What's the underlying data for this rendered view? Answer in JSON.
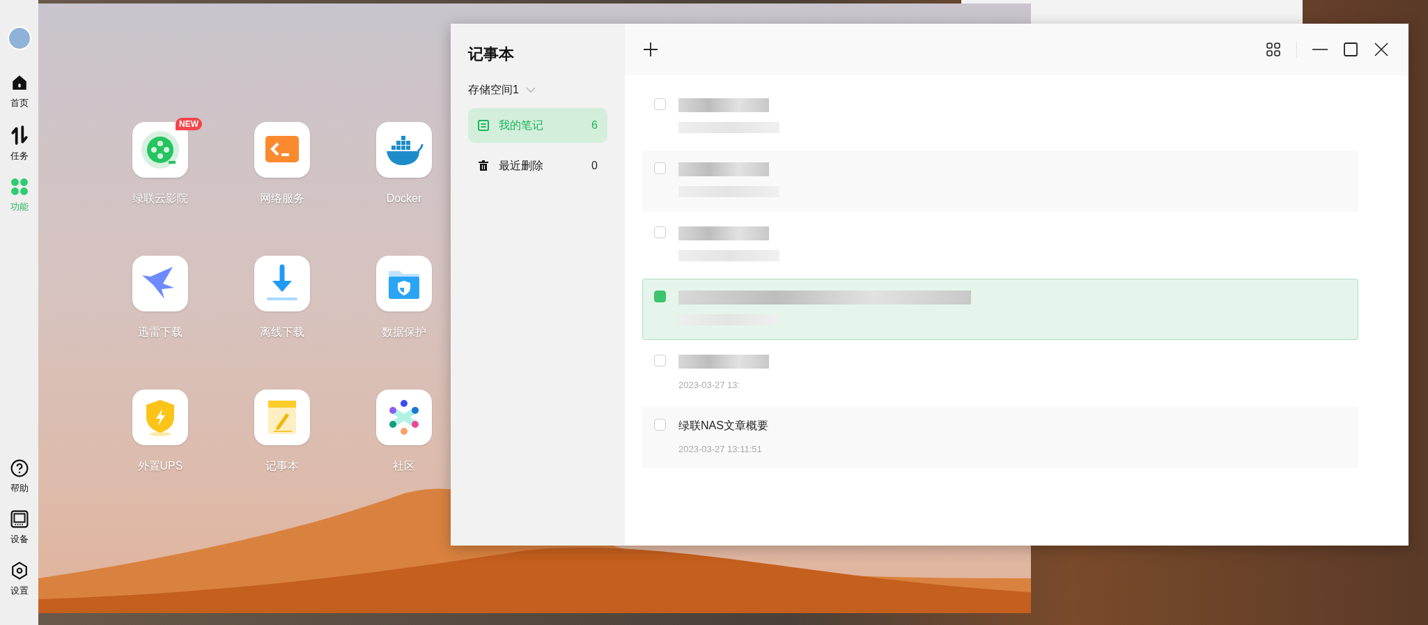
{
  "sidebar": {
    "items": [
      {
        "label": "首页",
        "selected": false
      },
      {
        "label": "任务",
        "selected": false
      },
      {
        "label": "功能",
        "selected": true
      }
    ],
    "bottom_items": [
      {
        "label": "帮助"
      },
      {
        "label": "设备"
      },
      {
        "label": "设置"
      }
    ]
  },
  "desktop": {
    "apps": [
      {
        "label": "绿联云影院",
        "badge": "NEW"
      },
      {
        "label": "网络服务"
      },
      {
        "label": "Docker"
      },
      {
        "label": "迅雷下载"
      },
      {
        "label": "离线下载"
      },
      {
        "label": "数据保护"
      },
      {
        "label": "外置UPS"
      },
      {
        "label": "记事本"
      },
      {
        "label": "社区"
      }
    ]
  },
  "notepad": {
    "title": "记事本",
    "storage": "存储空间1",
    "folders": [
      {
        "label": "我的笔记",
        "count": "6",
        "selected": true
      },
      {
        "label": "最近删除",
        "count": "0",
        "selected": false
      }
    ],
    "notes": [
      {
        "checked": false,
        "selected": false
      },
      {
        "checked": false,
        "selected": false
      },
      {
        "checked": false,
        "selected": false
      },
      {
        "checked": true,
        "selected": true
      },
      {
        "time": "2023-03-27 13:",
        "checked": false,
        "selected": false
      },
      {
        "title": "绿联NAS文章概要",
        "time": "2023-03-27 13:11:51",
        "checked": false,
        "selected": false
      }
    ]
  }
}
